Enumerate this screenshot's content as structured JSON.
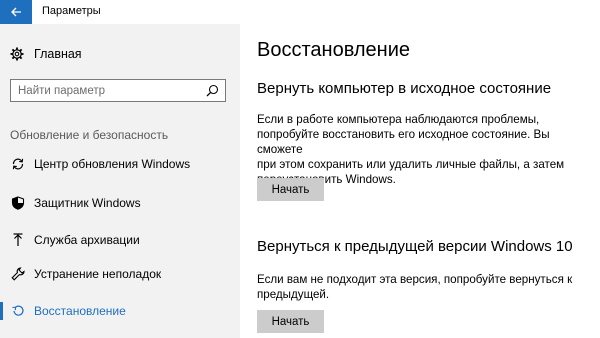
{
  "window": {
    "title": "Параметры"
  },
  "sidebar": {
    "home_label": "Главная",
    "search_placeholder": "Найти параметр",
    "section_header": "Обновление и безопасность",
    "items": [
      {
        "label": "Центр обновления Windows",
        "icon": "refresh-icon"
      },
      {
        "label": "Защитник Windows",
        "icon": "shield-icon"
      },
      {
        "label": "Служба архивации",
        "icon": "backup-arrow-icon"
      },
      {
        "label": "Устранение неполадок",
        "icon": "wrench-icon"
      },
      {
        "label": "Восстановление",
        "icon": "recovery-icon",
        "active": true
      }
    ]
  },
  "main": {
    "page_title": "Восстановление",
    "sections": [
      {
        "title": "Вернуть компьютер в исходное состояние",
        "lines": [
          "Если в работе компьютера наблюдаются проблемы,",
          "попробуйте восстановить его исходное состояние. Вы сможете",
          "при этом сохранить или удалить личные файлы, а затем",
          "переустановить Windows."
        ],
        "button": "Начать"
      },
      {
        "title": "Вернуться к предыдущей версии Windows 10",
        "lines": [
          "Если вам не подходит эта версия, попробуйте вернуться к",
          "предыдущей."
        ],
        "button": "Начать"
      }
    ]
  },
  "colors": {
    "accent": "#1f6fbf",
    "sidebar_bg": "#f2f2f2",
    "button_bg": "#cccccc"
  }
}
